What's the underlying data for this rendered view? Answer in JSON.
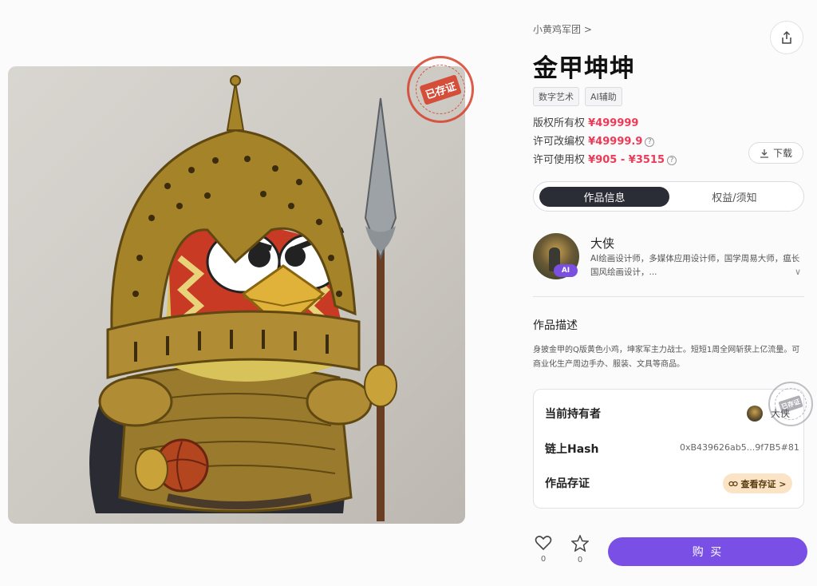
{
  "breadcrumb": "小黄鸡军团 >",
  "title": "金甲坤坤",
  "tags": [
    "数字艺术",
    "AI辅助"
  ],
  "rights": [
    {
      "label": "版权所有权",
      "price": "¥499999",
      "help": false
    },
    {
      "label": "许可改编权",
      "price": "¥49999.9",
      "help": true
    },
    {
      "label": "许可使用权",
      "price": "¥905 - ¥3515",
      "help": true
    }
  ],
  "download_label": "下载",
  "tabs": {
    "info": "作品信息",
    "rights": "权益/须知"
  },
  "creator": {
    "name": "大侠",
    "badge": "AI",
    "bio": "AI绘画设计师，多媒体应用设计师，国学周易大师，瘟长国风绘画设计，..."
  },
  "description": {
    "heading": "作品描述",
    "text": "身披金甲的Q版黄色小鸡，坤家军主力战士。短短1周全网斩获上亿流量。可商业化生产周边手办、服装、文具等商品。"
  },
  "holder": {
    "owner_label": "当前持有者",
    "owner_name": "大侠",
    "hash_label": "链上Hash",
    "hash_value": "0xB439626ab5...9f7B5#81",
    "cert_label": "作品存证",
    "cert_button": "查看存证 >"
  },
  "stamps": {
    "red": "已存证",
    "gray": "已存证"
  },
  "art_caption": "",
  "actions": {
    "likes": "0",
    "favorites": "0",
    "buy_label": "购 买"
  },
  "colors": {
    "accent": "#7a4fe6",
    "price": "#ee3a57",
    "tab_active": "#2b2d36",
    "cert_bg": "#fbe4c5"
  }
}
